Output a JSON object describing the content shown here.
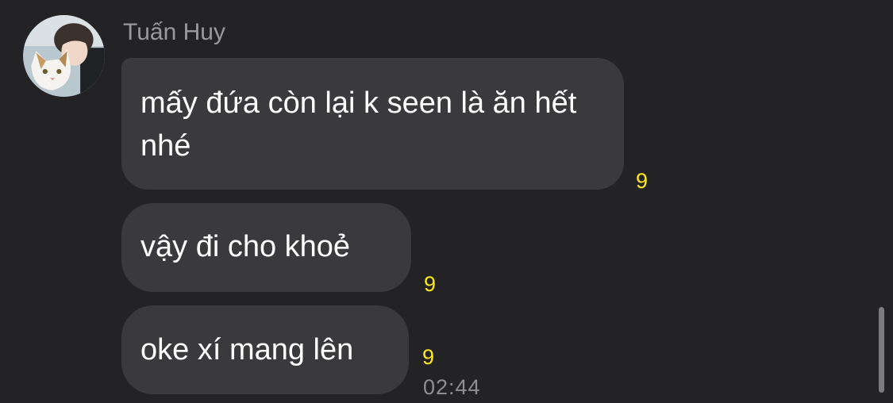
{
  "sender": {
    "name": "Tuấn Huy",
    "avatar": "avatar-photo-person-with-cat"
  },
  "messages": [
    {
      "text": "mấy đứa còn lại k seen là ăn hết nhé",
      "seen_count": "9"
    },
    {
      "text": "vậy đi cho khoẻ",
      "seen_count": "9"
    },
    {
      "text": "oke xí mang lên",
      "seen_count": "9"
    }
  ],
  "last_message_time": "02:44",
  "colors": {
    "background": "#232325",
    "bubble": "#3a3a3c",
    "message_text": "#ffffff",
    "sender_name": "#9a9a9e",
    "seen_count": "#ffe81a",
    "timestamp": "#8e8e93"
  }
}
